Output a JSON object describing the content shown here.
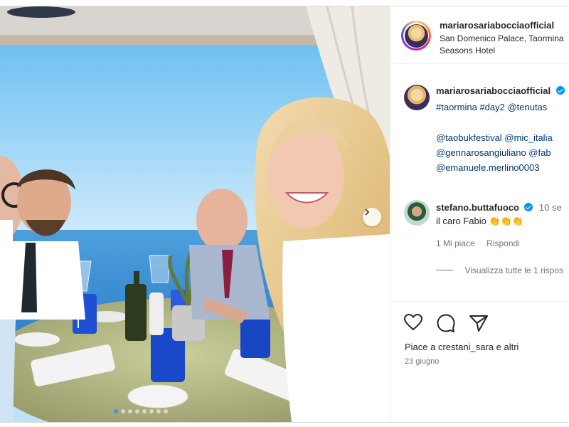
{
  "post": {
    "username": "mariarosariabocciaofficial",
    "location": "San Domenico Palace, Taormina, A Four Seasons Hotel",
    "location_line1": "San Domenico Palace, Taormina",
    "location_line2": "Seasons Hotel",
    "caption_user": "mariarosariabocciaofficial",
    "caption_lines": [
      "#taormina #day2 @tenutas",
      "@taobukfestival @mic_italia",
      "@gennarosangiuliano @fab",
      "@emanuele.merlino0003"
    ],
    "likes_text": "Piace a crestani_sara e altri",
    "date": "23 giugno",
    "carousel_total": 8,
    "carousel_active": 0
  },
  "comment": {
    "username": "stefano.buttafuoco",
    "age": "10 se",
    "text": "il caro Fabio 👏👏👏",
    "likes": "1 Mi piace",
    "reply": "Rispondi",
    "view_replies": "Visualizza tutte le 1 rispos"
  },
  "icons": {
    "like": "heart-icon",
    "comment": "comment-icon",
    "share": "share-icon",
    "next": "chevron-right-icon",
    "verified": "verified-badge-icon"
  },
  "colors": {
    "link": "#00376b",
    "verified": "#0095f6",
    "carousel_dot_active": "#3897f0",
    "muted": "#737373"
  }
}
